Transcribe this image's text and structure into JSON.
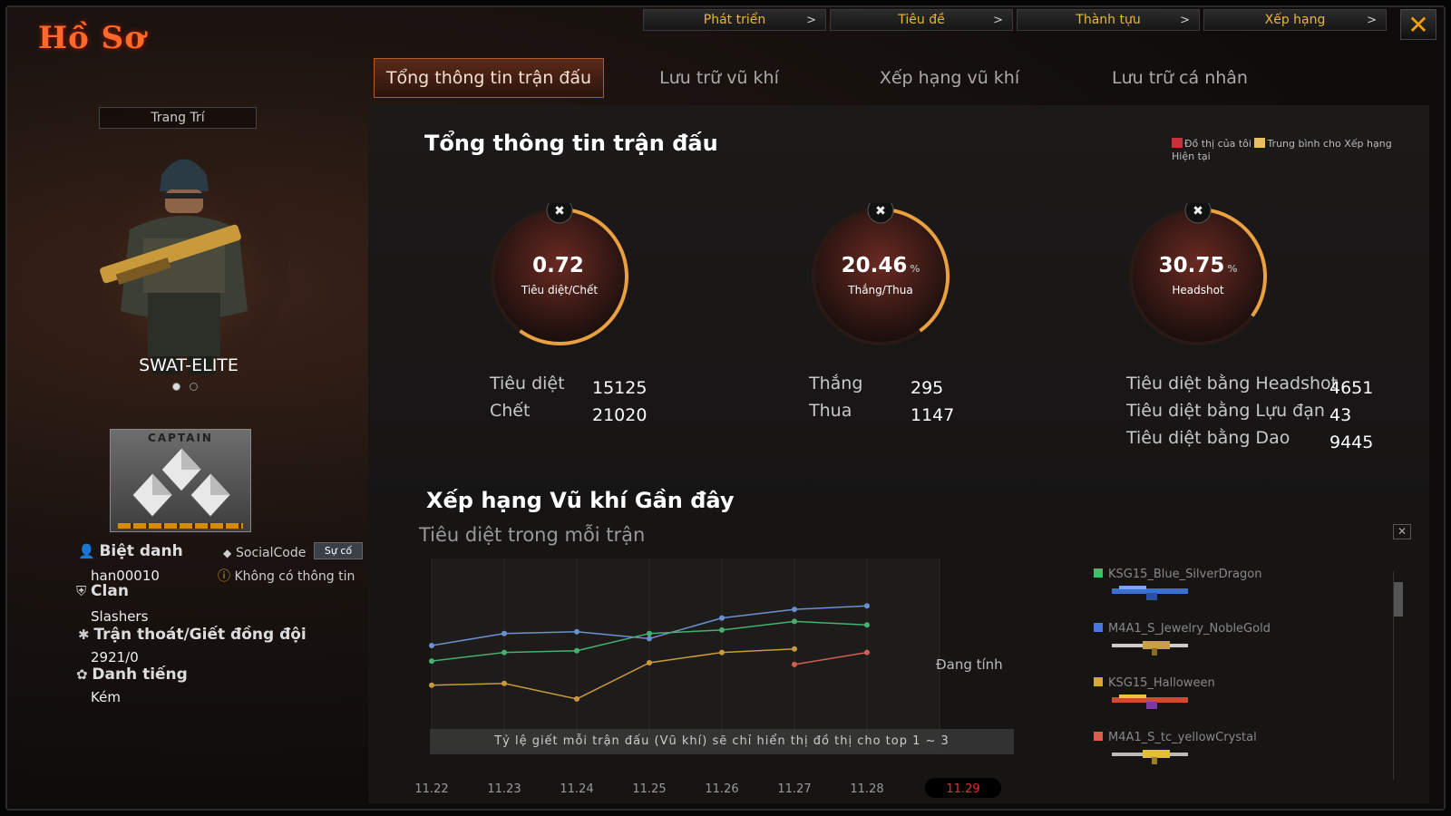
{
  "header": {
    "title": "Hồ Sơ",
    "topnav": [
      "Phát triển",
      "Tiêu đề",
      "Thành tựu",
      "Xếp hạng"
    ],
    "close": "✕"
  },
  "tabs": [
    "Tổng thông tin trận đấu",
    "Lưu trữ vũ khí",
    "Xếp hạng vũ khí",
    "Lưu trữ cá nhân"
  ],
  "profile": {
    "decor_button": "Trang Trí",
    "character": "SWAT-ELITE",
    "rank_title": "CAPTAIN",
    "nickname_label": "Biệt danh",
    "nickname": "han00010",
    "socialcode_label": "SocialCode",
    "socialcode_btn": "Sự cố",
    "socialcode_value": "Không có thông tin",
    "clan_label": "Clan",
    "clan": "Slashers",
    "desert_label": "Trận thoát/Giết đồng đội",
    "desert_value": "2921/0",
    "reputation_label": "Danh tiếng",
    "reputation": "Kém"
  },
  "summary": {
    "title": "Tổng thông tin trận đấu",
    "legend_mine": "Đồ thị của tôi",
    "legend_avg": "Trung bình cho Xếp hạng Hiện tại",
    "gauges": [
      {
        "value": "0.72",
        "unit": "",
        "label": "Tiêu diệt/Chết",
        "fill": 0.6,
        "icon": "skull-icon"
      },
      {
        "value": "20.46",
        "unit": "%",
        "label": "Thắng/Thua",
        "fill": 0.4,
        "icon": "crossed-rifles-icon"
      },
      {
        "value": "30.75",
        "unit": "%",
        "label": "Headshot",
        "fill": 0.35,
        "icon": "crosshair-rifle-icon"
      }
    ],
    "stats1": [
      {
        "label": "Tiêu diệt",
        "value": "15125"
      },
      {
        "label": "Chết",
        "value": "21020"
      }
    ],
    "stats2": [
      {
        "label": "Thắng",
        "value": "295"
      },
      {
        "label": "Thua",
        "value": "1147"
      }
    ],
    "stats3": [
      {
        "label": "Tiêu diệt bằng Headshot",
        "value": "4651"
      },
      {
        "label": "Tiêu diệt bằng Lựu đạn",
        "value": "43"
      },
      {
        "label": "Tiêu diệt bằng Dao",
        "value": "9445"
      }
    ]
  },
  "recent": {
    "title": "Xếp hạng Vũ khí Gần đây",
    "subtitle": "Tiêu diệt trong mỗi trận",
    "calculating": "Đang tính",
    "note": "Tỷ lệ giết mỗi trận đấu (Vũ khí) sẽ chỉ hiển thị đồ thị cho top 1 ~ 3",
    "weapons": [
      {
        "name": "KSG15_Blue_SilverDragon",
        "color": "#3ec06a"
      },
      {
        "name": "M4A1_S_Jewelry_NobleGold",
        "color": "#4a78d8"
      },
      {
        "name": "KSG15_Halloween",
        "color": "#d8a838"
      },
      {
        "name": "M4A1_S_tc_yellowCrystal",
        "color": "#d86050"
      }
    ]
  },
  "chart_data": {
    "type": "line",
    "title": "Tiêu diệt trong mỗi trận",
    "categories": [
      "11.22",
      "11.23",
      "11.24",
      "11.25",
      "11.26",
      "11.27",
      "11.28",
      "11.29"
    ],
    "highlight_category": "11.29",
    "ylim": [
      0,
      10
    ],
    "series": [
      {
        "name": "M4A1_S_Jewelry_NobleGold",
        "color": "#6b8fd0",
        "values": [
          6.0,
          6.7,
          6.8,
          6.4,
          7.6,
          8.1,
          8.3,
          null
        ]
      },
      {
        "name": "KSG15_Blue_SilverDragon",
        "color": "#47b070",
        "values": [
          5.1,
          5.6,
          5.7,
          6.7,
          6.9,
          7.4,
          7.2,
          null
        ]
      },
      {
        "name": "KSG15_Halloween",
        "color": "#c89a3c",
        "values": [
          3.7,
          3.8,
          2.9,
          5.0,
          5.6,
          5.8,
          null,
          null
        ]
      },
      {
        "name": "M4A1_S_tc_yellowCrystal",
        "color": "#d06050",
        "values": [
          null,
          null,
          null,
          null,
          null,
          4.9,
          5.6,
          null
        ]
      }
    ]
  }
}
